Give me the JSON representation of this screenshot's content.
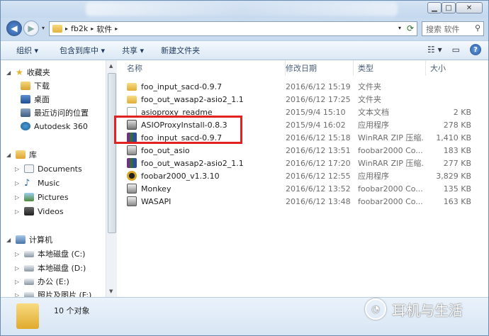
{
  "address": {
    "path": [
      "fb2k",
      "软件"
    ]
  },
  "search": {
    "placeholder": "搜索 软件"
  },
  "toolbar": {
    "organize": "组织 ▾",
    "include_library": "包含到库中 ▾",
    "share": "共享 ▾",
    "new_folder": "新建文件夹"
  },
  "nav": {
    "favorites": "收藏夹",
    "downloads": "下载",
    "desktop": "桌面",
    "recent": "最近访问的位置",
    "autodesk": "Autodesk 360",
    "libraries": "库",
    "documents": "Documents",
    "music": "Music",
    "pictures": "Pictures",
    "videos": "Videos",
    "computer": "计算机",
    "drive_c": "本地磁盘 (C:)",
    "drive_d": "本地磁盘 (D:)",
    "drive_e": "办公 (E:)",
    "drive_f": "照片及图片 (F:)"
  },
  "columns": {
    "name": "名称",
    "date": "修改日期",
    "type": "类型",
    "size": "大小"
  },
  "files": [
    {
      "name": "foo_input_sacd-0.9.7",
      "date": "2016/6/12 15:19",
      "type": "文件夹",
      "size": "",
      "icon": "folder-icon"
    },
    {
      "name": "foo_out_wasap2-asio2_1.1",
      "date": "2016/6/12 17:25",
      "type": "文件夹",
      "size": "",
      "icon": "folder-icon"
    },
    {
      "name": "asioproxy_readme",
      "date": "2015/9/4 15:10",
      "type": "文本文档",
      "size": "2 KB",
      "icon": "text-file-icon"
    },
    {
      "name": "ASIOProxyInstall-0.8.3",
      "date": "2015/9/4 16:02",
      "type": "应用程序",
      "size": "278 KB",
      "icon": "installer-icon"
    },
    {
      "name": "foo_input_sacd-0.9.7",
      "date": "2016/6/12 15:18",
      "type": "WinRAR ZIP 压缩...",
      "size": "1,410 KB",
      "icon": "winrar-icon"
    },
    {
      "name": "foo_out_asio",
      "date": "2016/6/12 13:51",
      "type": "foobar2000 Co...",
      "size": "183 KB",
      "icon": "foobar-component-icon"
    },
    {
      "name": "foo_out_wasap2-asio2_1.1",
      "date": "2016/6/12 17:20",
      "type": "WinRAR ZIP 压缩...",
      "size": "277 KB",
      "icon": "winrar-icon"
    },
    {
      "name": "foobar2000_v1.3.10",
      "date": "2016/6/12 12:55",
      "type": "应用程序",
      "size": "3,829 KB",
      "icon": "foobar-icon"
    },
    {
      "name": "Monkey",
      "date": "2016/6/12 13:52",
      "type": "foobar2000 Co...",
      "size": "135 KB",
      "icon": "foobar-component-icon"
    },
    {
      "name": "WASAPI",
      "date": "2016/6/12 13:48",
      "type": "foobar2000 Co...",
      "size": "163 KB",
      "icon": "foobar-component-icon"
    }
  ],
  "status": {
    "count": "10 个对象"
  },
  "watermark": {
    "text": "耳机与生活"
  }
}
